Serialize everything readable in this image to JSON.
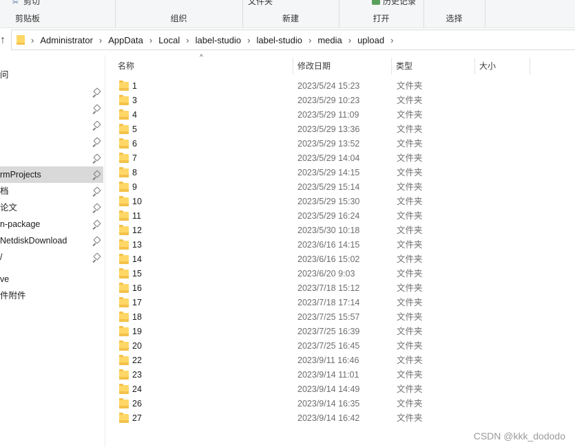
{
  "ribbon": {
    "clipboard": {
      "top": "剪切",
      "label": "剪贴板"
    },
    "organize": {
      "label": "组织"
    },
    "new": {
      "top": "文件夹",
      "label": "新建"
    },
    "open": {
      "top": "历史记录",
      "label": "打开"
    },
    "select": {
      "label": "选择"
    }
  },
  "address": {
    "nav_up": "↑",
    "sep": "›",
    "crumbs": [
      "Administrator",
      "AppData",
      "Local",
      "label-studio",
      "label-studio",
      "media",
      "upload"
    ]
  },
  "sidebar": {
    "items": [
      {
        "label": "问",
        "pinned": false
      },
      {
        "label": "",
        "pinned": true
      },
      {
        "label": "",
        "pinned": true
      },
      {
        "label": "",
        "pinned": true
      },
      {
        "label": "",
        "pinned": true
      },
      {
        "label": "",
        "pinned": true
      },
      {
        "label": "rmProjects",
        "pinned": true,
        "selected": true
      },
      {
        "label": "档",
        "pinned": true
      },
      {
        "label": "论文",
        "pinned": true
      },
      {
        "label": "n-package",
        "pinned": true
      },
      {
        "label": "NetdiskDownload",
        "pinned": true
      },
      {
        "label": "/",
        "pinned": true
      },
      {
        "label": "ve",
        "pinned": false
      },
      {
        "label": "件附件",
        "pinned": false
      }
    ]
  },
  "columns": {
    "name": "名称",
    "date": "修改日期",
    "type": "类型",
    "size": "大小",
    "sort_indicator": "^"
  },
  "files": [
    {
      "name": "1",
      "date": "2023/5/24 15:23",
      "type": "文件夹"
    },
    {
      "name": "3",
      "date": "2023/5/29 10:23",
      "type": "文件夹"
    },
    {
      "name": "4",
      "date": "2023/5/29 11:09",
      "type": "文件夹"
    },
    {
      "name": "5",
      "date": "2023/5/29 13:36",
      "type": "文件夹"
    },
    {
      "name": "6",
      "date": "2023/5/29 13:52",
      "type": "文件夹"
    },
    {
      "name": "7",
      "date": "2023/5/29 14:04",
      "type": "文件夹"
    },
    {
      "name": "8",
      "date": "2023/5/29 14:15",
      "type": "文件夹"
    },
    {
      "name": "9",
      "date": "2023/5/29 15:14",
      "type": "文件夹"
    },
    {
      "name": "10",
      "date": "2023/5/29 15:30",
      "type": "文件夹"
    },
    {
      "name": "11",
      "date": "2023/5/29 16:24",
      "type": "文件夹"
    },
    {
      "name": "12",
      "date": "2023/5/30 10:18",
      "type": "文件夹"
    },
    {
      "name": "13",
      "date": "2023/6/16 14:15",
      "type": "文件夹"
    },
    {
      "name": "14",
      "date": "2023/6/16 15:02",
      "type": "文件夹"
    },
    {
      "name": "15",
      "date": "2023/6/20 9:03",
      "type": "文件夹"
    },
    {
      "name": "16",
      "date": "2023/7/18 15:12",
      "type": "文件夹"
    },
    {
      "name": "17",
      "date": "2023/7/18 17:14",
      "type": "文件夹"
    },
    {
      "name": "18",
      "date": "2023/7/25 15:57",
      "type": "文件夹"
    },
    {
      "name": "19",
      "date": "2023/7/25 16:39",
      "type": "文件夹"
    },
    {
      "name": "20",
      "date": "2023/7/25 16:45",
      "type": "文件夹"
    },
    {
      "name": "22",
      "date": "2023/9/11 16:46",
      "type": "文件夹"
    },
    {
      "name": "23",
      "date": "2023/9/14 11:01",
      "type": "文件夹"
    },
    {
      "name": "24",
      "date": "2023/9/14 14:49",
      "type": "文件夹"
    },
    {
      "name": "26",
      "date": "2023/9/14 16:35",
      "type": "文件夹"
    },
    {
      "name": "27",
      "date": "2023/9/14 16:42",
      "type": "文件夹"
    }
  ],
  "watermark": "CSDN @kkk_dododo",
  "colors": {
    "folder": "#ffd767",
    "selected": "#d9d9d9"
  }
}
